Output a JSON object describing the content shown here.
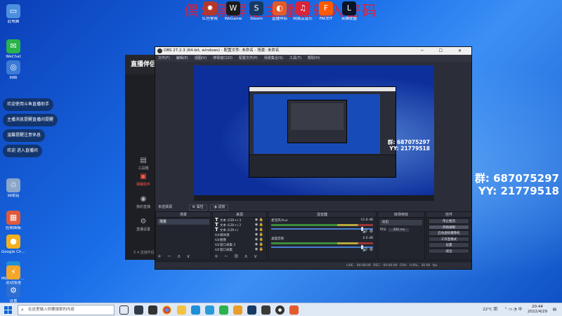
{
  "watermark": "偶尔黑屏是主播在输入密码",
  "qq": {
    "big_group": "群: 687075297",
    "big_yy": "YY: 21779518",
    "small_group": "群: 687075297",
    "small_yy": "YY: 21779518"
  },
  "desktop_icons_left": [
    {
      "label": "此电脑",
      "color": "#4c8fe0",
      "g": "▭"
    },
    {
      "label": "WeChat",
      "color": "#2ab34a",
      "g": "✉"
    },
    {
      "label": "网络",
      "color": "#3b7bd6",
      "g": "◎"
    },
    {
      "label": "回收站",
      "color": "#8aa6c8",
      "g": "♲"
    },
    {
      "label": "控制面板",
      "color": "#e05a3a",
      "g": "▦"
    },
    {
      "label": "Google Chrome",
      "color": "#f2b01e",
      "g": "●"
    },
    {
      "label": "Microsoft Edge",
      "color": "#1f8fd8",
      "g": "e"
    },
    {
      "label": "设置",
      "color": "#2d6ed0",
      "g": "⚙"
    },
    {
      "label": "凌动加速",
      "color": "#f4a62a",
      "g": "⚡"
    }
  ],
  "desktop_icons_top": [
    {
      "label": "红色警戒",
      "color": "#b4382c",
      "g": "✸"
    },
    {
      "label": "WeGame",
      "color": "#1a1a1a",
      "g": "W"
    },
    {
      "label": "Steam",
      "color": "#173a64",
      "g": "S"
    },
    {
      "label": "直播伴侣",
      "color": "#e25b2b",
      "g": "◐"
    },
    {
      "label": "网易云音乐",
      "color": "#d9243a",
      "g": "♫"
    },
    {
      "label": "FACEIT",
      "color": "#ff5a00",
      "g": "F"
    },
    {
      "label": "英雄联盟",
      "color": "#0a1428",
      "g": "L"
    }
  ],
  "balloons": [
    "欢迎使用斗鱼直播助手",
    "主播消息提醒直播间提醒",
    "温馨提醒注意休息",
    "欢迎 进入直播间"
  ],
  "stream_app": {
    "logo": "直播伴侣",
    "items": [
      "工具箱",
      "弹幕助手",
      "我的直播",
      "直播设置"
    ],
    "footer": "5.4 直播伴侣"
  },
  "obs": {
    "title": "OBS 27.2.3 (64-bit, windows) - 配置文件: 未命名 - 场景: 未命名",
    "menu": [
      "文件(F)",
      "编辑(E)",
      "视图(V)",
      "停靠窗口(D)",
      "配置文件(P)",
      "场景集合(S)",
      "工具(T)",
      "帮助(H)"
    ],
    "scene_label": "未选择源",
    "prop_btn": "属性",
    "filter_btn": "滤镜",
    "dock_titles": [
      "场景",
      "来源",
      "混音器",
      "转场特效",
      "控件"
    ],
    "scenes": [
      "场景"
    ],
    "sources": [
      "文本 (GDI+) 3",
      "文本 (GDI+) 2",
      "文本 (GDI+)",
      "媒体源",
      "图像",
      "窗口采集 2",
      "窗口采集"
    ],
    "mixer": [
      {
        "name": "麦克风/Aux",
        "db": "-11.8 dB"
      },
      {
        "name": "桌面音频",
        "db": "0.0 dB"
      }
    ],
    "transition": {
      "type": "淡出",
      "duration_label": "时长",
      "duration": "300 ms"
    },
    "controls": [
      "停止推流",
      "开始录制",
      "启动虚拟摄像机",
      "工作室模式",
      "设置",
      "退出"
    ],
    "status": "LIVE: 00:00:00   REC: 00:00:00   CPU: 0.6%, 30.00 fps"
  },
  "taskbar": {
    "search_placeholder": "在这里输入你要搜索的内容",
    "weather": "22°C 阴",
    "time": "20:44",
    "date": "2022/4/29",
    "lang": "中"
  }
}
